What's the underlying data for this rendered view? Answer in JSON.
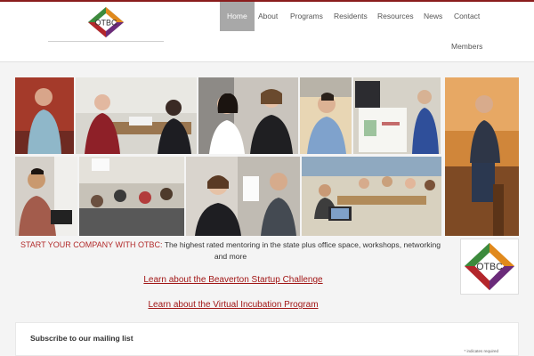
{
  "header": {
    "logo_text": "OTBC"
  },
  "nav": {
    "items": [
      {
        "label": "Home",
        "active": true
      },
      {
        "label": "About",
        "active": false
      },
      {
        "label": "Programs",
        "active": false
      },
      {
        "label": "Residents",
        "active": false
      },
      {
        "label": "Resources",
        "active": false
      },
      {
        "label": "News",
        "active": false
      },
      {
        "label": "Contact",
        "active": false
      },
      {
        "label": "Members",
        "active": false
      }
    ]
  },
  "hero": {
    "headline_accent": "START YOUR COMPANY WITH OTBC:",
    "headline_body": "The highest rated mentoring in the state plus office space, workshops, networking and more",
    "side_logo_text": "OTBC"
  },
  "links": {
    "startup_challenge": "Learn about the Beaverton Startup Challenge",
    "virtual_incubation": "Learn about the Virtual Incubation Program"
  },
  "subscribe": {
    "title": "Subscribe to our mailing list",
    "required_note": "* indicates required"
  },
  "colors": {
    "accent_red": "#b22b2b",
    "nav_active_bg": "#a8a8a8",
    "logo_green": "#3c8a3c",
    "logo_orange": "#e0891c",
    "logo_purple": "#6b2b7a",
    "logo_red": "#b3262b"
  }
}
